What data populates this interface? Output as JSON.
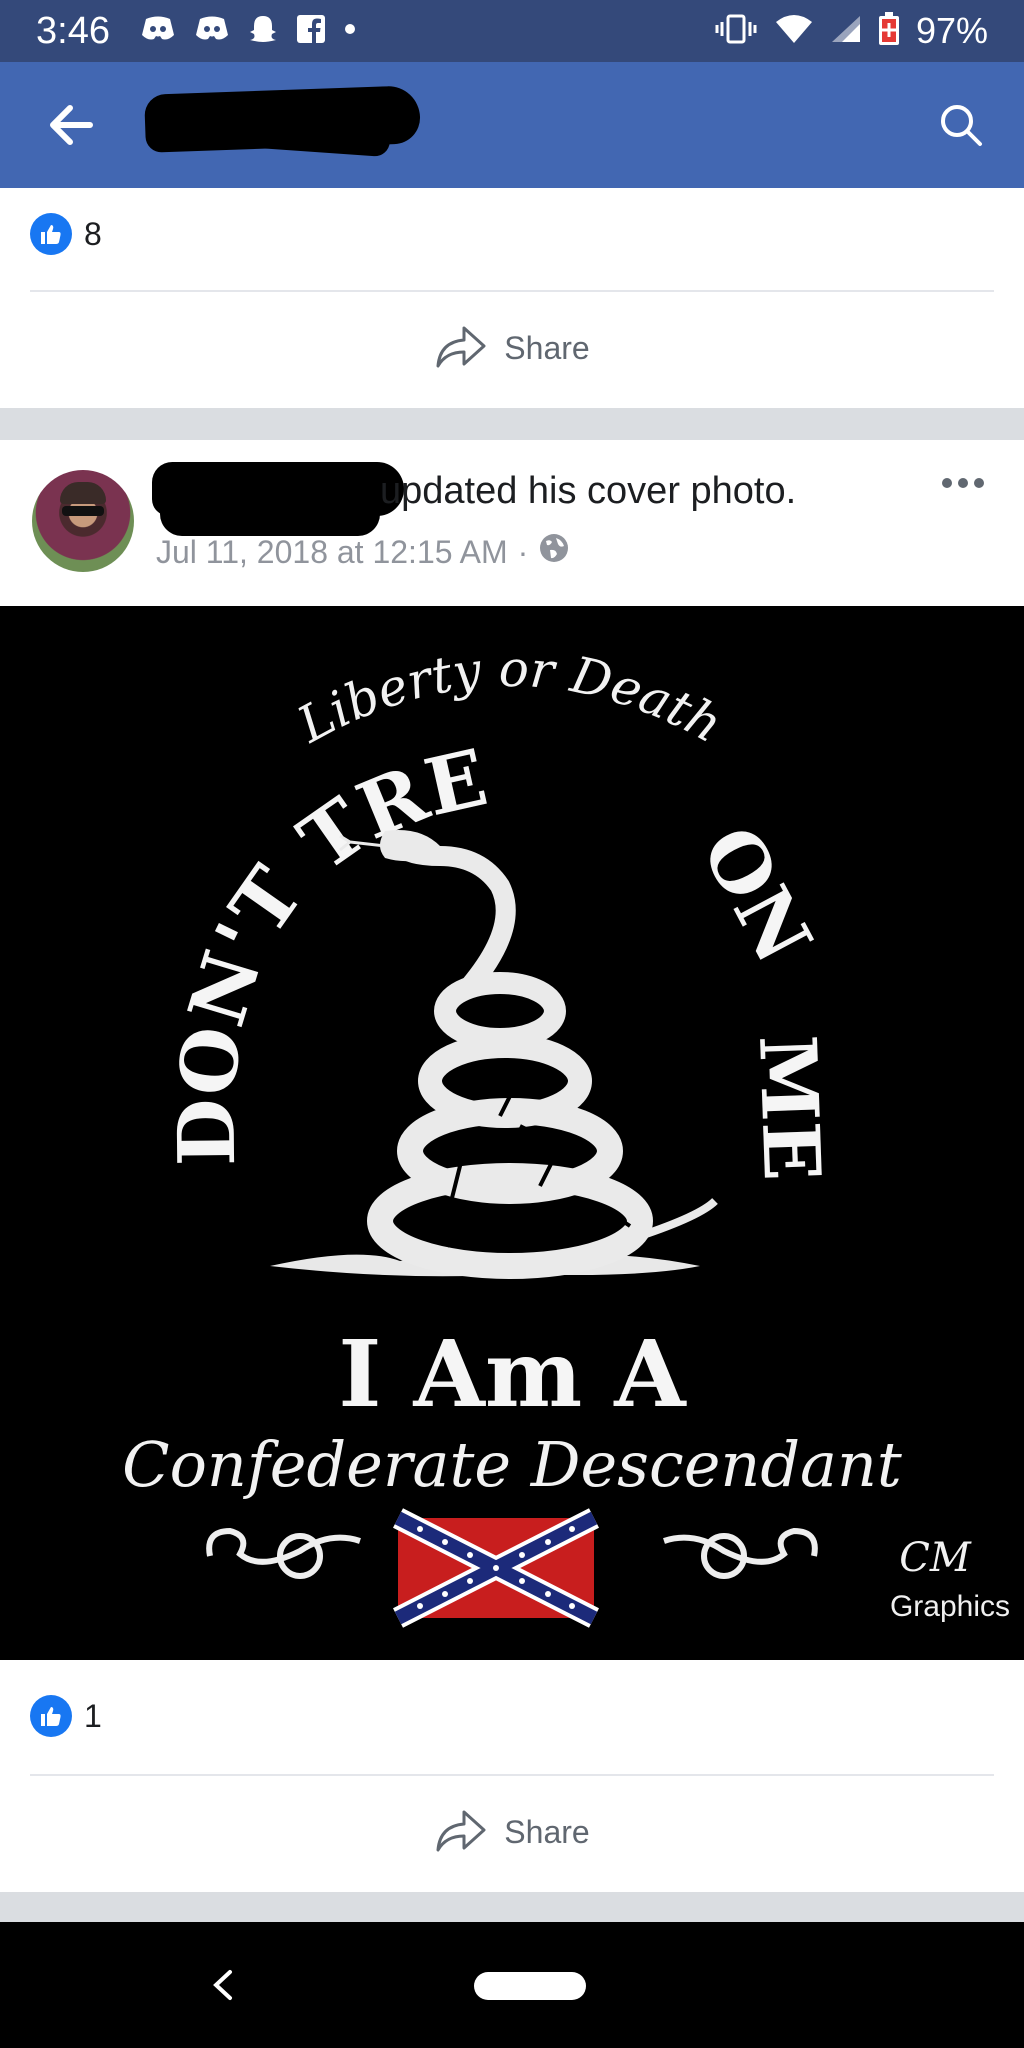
{
  "status_bar": {
    "time": "3:46",
    "battery": "97%",
    "icons": [
      "discord-icon",
      "discord-icon",
      "snapchat-icon",
      "facebook-icon",
      "dot-icon",
      "vibrate-icon",
      "wifi-icon",
      "signal-icon",
      "battery-icon"
    ]
  },
  "app_bar": {
    "icons": [
      "back-arrow-icon",
      "search-icon"
    ],
    "bg_color": "#4267b2"
  },
  "post1": {
    "like_count": "8",
    "share_label": "Share"
  },
  "post2": {
    "title": "updated his cover photo.",
    "timestamp": "Jul 11, 2018 at 12:15 AM",
    "separator": "·",
    "privacy": "globe-icon",
    "like_count": "1",
    "share_label": "Share",
    "image": {
      "line1": "Liberty or Death",
      "line2": "DON'T TREAD ON ME",
      "line3": "I Am A",
      "line4": "Confederate Descendant",
      "watermark_top": "CM",
      "watermark_bottom": "Graphics"
    }
  },
  "colors": {
    "like_blue": "#1877f2",
    "text_gray": "#90949c"
  }
}
